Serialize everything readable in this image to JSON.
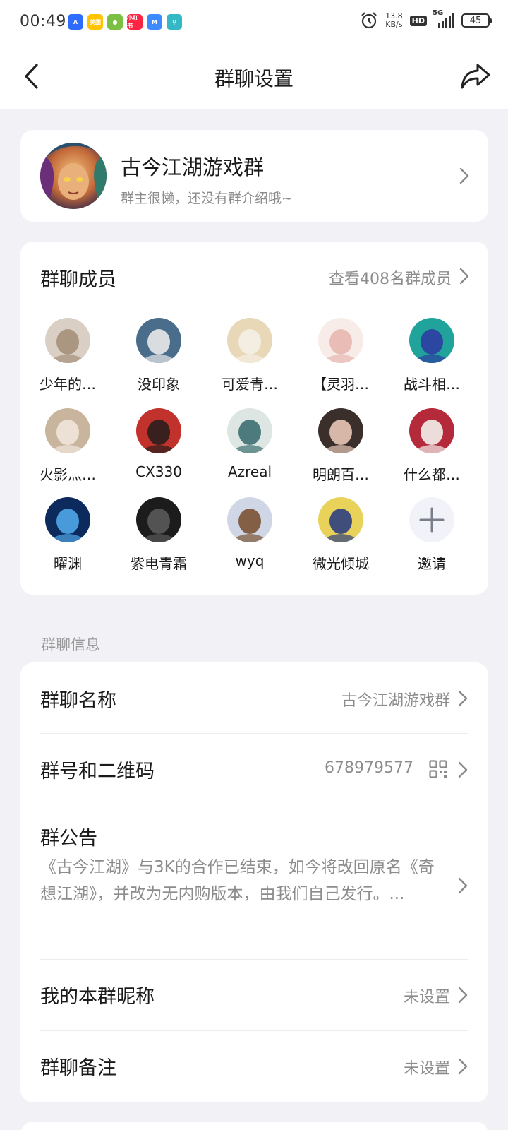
{
  "status_bar": {
    "time": "00:49",
    "net_speed_value": "13.8",
    "net_speed_unit": "KB/s",
    "hd": "HD",
    "network": "5G",
    "battery": "45",
    "apps": [
      {
        "name": "app-a-icon",
        "text": "A",
        "color": "#2f6bff"
      },
      {
        "name": "meituan-icon",
        "text": "美团",
        "color": "#ffc300"
      },
      {
        "name": "green-app-icon",
        "text": "●",
        "color": "#7bc043"
      },
      {
        "name": "xiaohongshu-icon",
        "text": "小红书",
        "color": "#ff2442"
      },
      {
        "name": "blue-app-icon",
        "text": "M",
        "color": "#3d8bff"
      },
      {
        "name": "teal-app-icon",
        "text": "⚲",
        "color": "#35b8c6"
      }
    ]
  },
  "header": {
    "title": "群聊设置"
  },
  "group": {
    "name": "古今江湖游戏群",
    "description": "群主很懒，还没有群介绍哦~"
  },
  "members": {
    "title": "群聊成员",
    "view_all": "查看408名群成员",
    "list": [
      {
        "name": "少年的…",
        "color": "#d9cfc4",
        "accent": "#a58f7a"
      },
      {
        "name": "没印象",
        "color": "#4a6d8c",
        "accent": "#e9e9e9"
      },
      {
        "name": "可爱青…",
        "color": "#e8d8b8",
        "accent": "#f5f0e6"
      },
      {
        "name": "【灵羽…",
        "color": "#f7ece8",
        "accent": "#e7b8b0"
      },
      {
        "name": "战斗相…",
        "color": "#1fa39a",
        "accent": "#2c3da3"
      },
      {
        "name": "火影灬…",
        "color": "#c9b49e",
        "accent": "#f1e6dc"
      },
      {
        "name": "CX330",
        "color": "#c0322b",
        "accent": "#2a1d1d"
      },
      {
        "name": "Azreal",
        "color": "#dde6e2",
        "accent": "#3d6f72"
      },
      {
        "name": "明朗百…",
        "color": "#3b2f2c",
        "accent": "#e8c7b6"
      },
      {
        "name": "什么都…",
        "color": "#b52a3a",
        "accent": "#f2efec"
      },
      {
        "name": "曜渊",
        "color": "#0d2a5c",
        "accent": "#4fa6e8"
      },
      {
        "name": "紫电青霜",
        "color": "#1c1c1c",
        "accent": "#5a5a5a"
      },
      {
        "name": "wyq",
        "color": "#cfd6e6",
        "accent": "#7a5233"
      },
      {
        "name": "微光倾城",
        "color": "#e8d25a",
        "accent": "#2d3f7e"
      }
    ],
    "invite_label": "邀请"
  },
  "info_section": {
    "label": "群聊信息",
    "group_name_label": "群聊名称",
    "group_name_value": "古今江湖游戏群",
    "group_id_label": "群号和二维码",
    "group_id_value": "678979577",
    "notice_label": "群公告",
    "notice_text": "《古今江湖》与3K的合作已结束，如今将改回原名《奇想江湖》，并改为无内购版本，由我们自己发行。...",
    "nickname_label": "我的本群昵称",
    "nickname_value": "未设置",
    "remark_label": "群聊备注",
    "remark_value": "未设置"
  }
}
